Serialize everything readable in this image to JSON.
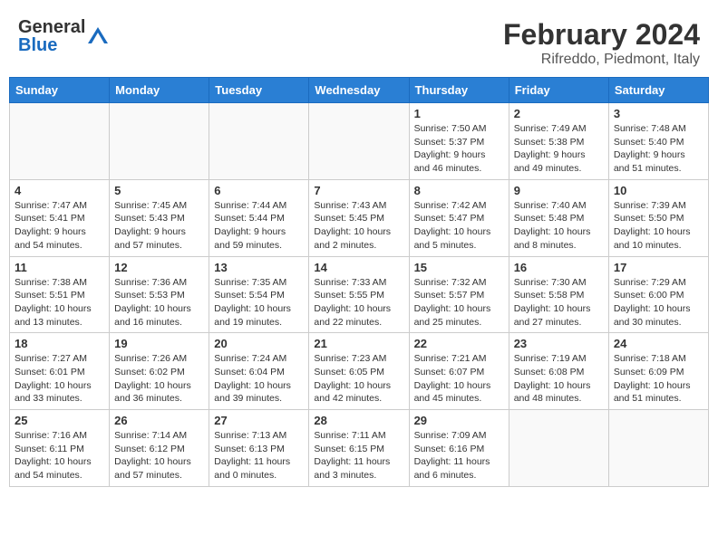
{
  "header": {
    "logo_general": "General",
    "logo_blue": "Blue",
    "month_title": "February 2024",
    "location": "Rifreddo, Piedmont, Italy"
  },
  "weekdays": [
    "Sunday",
    "Monday",
    "Tuesday",
    "Wednesday",
    "Thursday",
    "Friday",
    "Saturday"
  ],
  "weeks": [
    [
      {
        "day": "",
        "info": ""
      },
      {
        "day": "",
        "info": ""
      },
      {
        "day": "",
        "info": ""
      },
      {
        "day": "",
        "info": ""
      },
      {
        "day": "1",
        "info": "Sunrise: 7:50 AM\nSunset: 5:37 PM\nDaylight: 9 hours\nand 46 minutes."
      },
      {
        "day": "2",
        "info": "Sunrise: 7:49 AM\nSunset: 5:38 PM\nDaylight: 9 hours\nand 49 minutes."
      },
      {
        "day": "3",
        "info": "Sunrise: 7:48 AM\nSunset: 5:40 PM\nDaylight: 9 hours\nand 51 minutes."
      }
    ],
    [
      {
        "day": "4",
        "info": "Sunrise: 7:47 AM\nSunset: 5:41 PM\nDaylight: 9 hours\nand 54 minutes."
      },
      {
        "day": "5",
        "info": "Sunrise: 7:45 AM\nSunset: 5:43 PM\nDaylight: 9 hours\nand 57 minutes."
      },
      {
        "day": "6",
        "info": "Sunrise: 7:44 AM\nSunset: 5:44 PM\nDaylight: 9 hours\nand 59 minutes."
      },
      {
        "day": "7",
        "info": "Sunrise: 7:43 AM\nSunset: 5:45 PM\nDaylight: 10 hours\nand 2 minutes."
      },
      {
        "day": "8",
        "info": "Sunrise: 7:42 AM\nSunset: 5:47 PM\nDaylight: 10 hours\nand 5 minutes."
      },
      {
        "day": "9",
        "info": "Sunrise: 7:40 AM\nSunset: 5:48 PM\nDaylight: 10 hours\nand 8 minutes."
      },
      {
        "day": "10",
        "info": "Sunrise: 7:39 AM\nSunset: 5:50 PM\nDaylight: 10 hours\nand 10 minutes."
      }
    ],
    [
      {
        "day": "11",
        "info": "Sunrise: 7:38 AM\nSunset: 5:51 PM\nDaylight: 10 hours\nand 13 minutes."
      },
      {
        "day": "12",
        "info": "Sunrise: 7:36 AM\nSunset: 5:53 PM\nDaylight: 10 hours\nand 16 minutes."
      },
      {
        "day": "13",
        "info": "Sunrise: 7:35 AM\nSunset: 5:54 PM\nDaylight: 10 hours\nand 19 minutes."
      },
      {
        "day": "14",
        "info": "Sunrise: 7:33 AM\nSunset: 5:55 PM\nDaylight: 10 hours\nand 22 minutes."
      },
      {
        "day": "15",
        "info": "Sunrise: 7:32 AM\nSunset: 5:57 PM\nDaylight: 10 hours\nand 25 minutes."
      },
      {
        "day": "16",
        "info": "Sunrise: 7:30 AM\nSunset: 5:58 PM\nDaylight: 10 hours\nand 27 minutes."
      },
      {
        "day": "17",
        "info": "Sunrise: 7:29 AM\nSunset: 6:00 PM\nDaylight: 10 hours\nand 30 minutes."
      }
    ],
    [
      {
        "day": "18",
        "info": "Sunrise: 7:27 AM\nSunset: 6:01 PM\nDaylight: 10 hours\nand 33 minutes."
      },
      {
        "day": "19",
        "info": "Sunrise: 7:26 AM\nSunset: 6:02 PM\nDaylight: 10 hours\nand 36 minutes."
      },
      {
        "day": "20",
        "info": "Sunrise: 7:24 AM\nSunset: 6:04 PM\nDaylight: 10 hours\nand 39 minutes."
      },
      {
        "day": "21",
        "info": "Sunrise: 7:23 AM\nSunset: 6:05 PM\nDaylight: 10 hours\nand 42 minutes."
      },
      {
        "day": "22",
        "info": "Sunrise: 7:21 AM\nSunset: 6:07 PM\nDaylight: 10 hours\nand 45 minutes."
      },
      {
        "day": "23",
        "info": "Sunrise: 7:19 AM\nSunset: 6:08 PM\nDaylight: 10 hours\nand 48 minutes."
      },
      {
        "day": "24",
        "info": "Sunrise: 7:18 AM\nSunset: 6:09 PM\nDaylight: 10 hours\nand 51 minutes."
      }
    ],
    [
      {
        "day": "25",
        "info": "Sunrise: 7:16 AM\nSunset: 6:11 PM\nDaylight: 10 hours\nand 54 minutes."
      },
      {
        "day": "26",
        "info": "Sunrise: 7:14 AM\nSunset: 6:12 PM\nDaylight: 10 hours\nand 57 minutes."
      },
      {
        "day": "27",
        "info": "Sunrise: 7:13 AM\nSunset: 6:13 PM\nDaylight: 11 hours\nand 0 minutes."
      },
      {
        "day": "28",
        "info": "Sunrise: 7:11 AM\nSunset: 6:15 PM\nDaylight: 11 hours\nand 3 minutes."
      },
      {
        "day": "29",
        "info": "Sunrise: 7:09 AM\nSunset: 6:16 PM\nDaylight: 11 hours\nand 6 minutes."
      },
      {
        "day": "",
        "info": ""
      },
      {
        "day": "",
        "info": ""
      }
    ]
  ]
}
